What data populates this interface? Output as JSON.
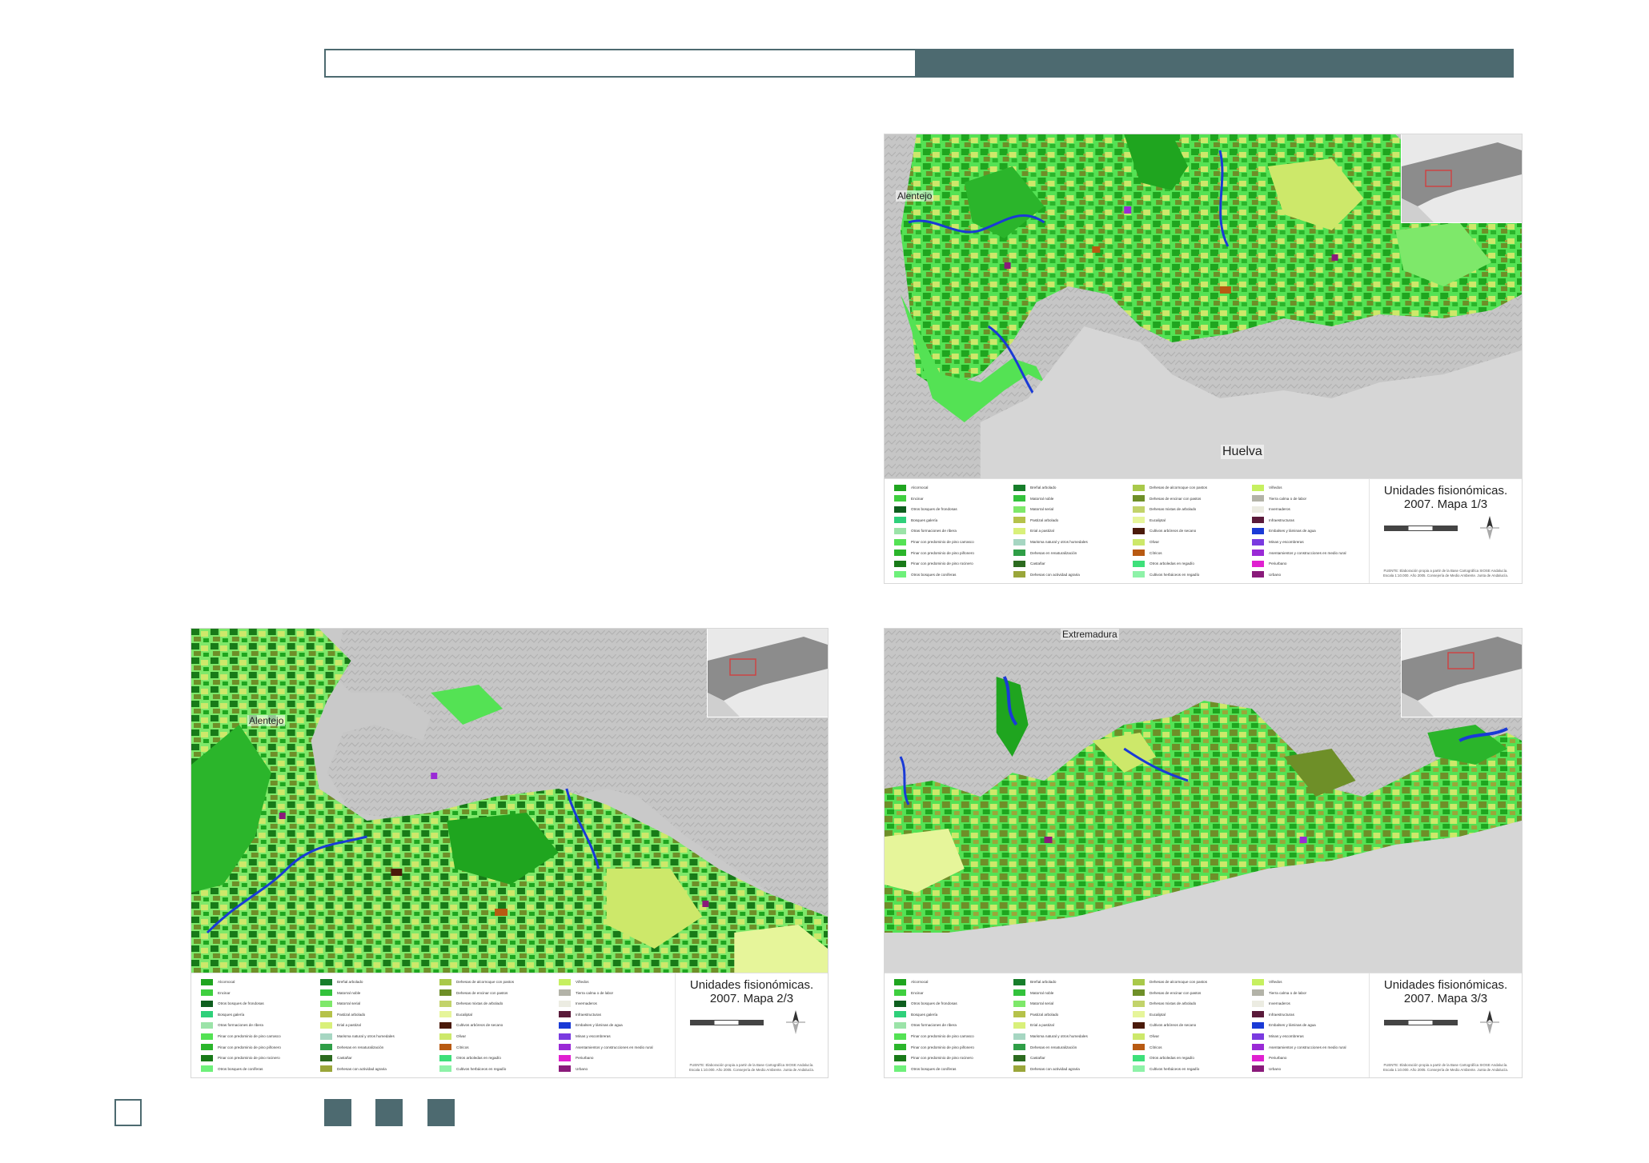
{
  "maps": [
    {
      "title_line1": "Unidades fisionómicas.",
      "title_line2": "2007. Mapa 1/3",
      "places": [
        "Alentejo",
        "Huelva"
      ]
    },
    {
      "title_line1": "Unidades fisionómicas.",
      "title_line2": "2007. Mapa 2/3",
      "places": [
        "Alentejo"
      ]
    },
    {
      "title_line1": "Unidades fisionómicas.",
      "title_line2": "2007. Mapa 3/3",
      "places": [
        "Extremadura"
      ]
    }
  ],
  "legend": [
    {
      "label": "Alcornocal",
      "color": "#1fa51f"
    },
    {
      "label": "Encinar",
      "color": "#3fcf3f"
    },
    {
      "label": "Otros bosques de frondosas",
      "color": "#0e5e1e"
    },
    {
      "label": "Bosques galería",
      "color": "#2ed07a"
    },
    {
      "label": "Otras formaciones de ribera",
      "color": "#9be3a8"
    },
    {
      "label": "Pinar con predominio de pino carrasco",
      "color": "#54e254"
    },
    {
      "label": "Pinar con predominio de pino piñonero",
      "color": "#2bb52b"
    },
    {
      "label": "Pinar con predominio de pino rocinero",
      "color": "#187a18"
    },
    {
      "label": "Otros bosques de coníferas",
      "color": "#6ef07a"
    },
    {
      "label": "Breñal arbolado",
      "color": "#167d2a"
    },
    {
      "label": "Matorral noble",
      "color": "#33c23c"
    },
    {
      "label": "Matorral serial",
      "color": "#7ee86a"
    },
    {
      "label": "Pastizal arbolado",
      "color": "#b5c24a"
    },
    {
      "label": "Erial a pastizal",
      "color": "#d9f07a"
    },
    {
      "label": "Marisma natural y otros humedales",
      "color": "#a6d6c2"
    },
    {
      "label": "Dehesas en renaturalización",
      "color": "#2f9e47"
    },
    {
      "label": "Castañar",
      "color": "#2c6b1f"
    },
    {
      "label": "Dehesas con actividad agraria",
      "color": "#9aa63a"
    },
    {
      "label": "Dehesas de alcornoque con pastos",
      "color": "#a9c94a"
    },
    {
      "label": "Dehesas de encinar con pastos",
      "color": "#6e8f28"
    },
    {
      "label": "Dehesas mixtas de arbolado",
      "color": "#c2d36a"
    },
    {
      "label": "Eucaliptal",
      "color": "#e6f59a"
    },
    {
      "label": "Cultivos arbóreos de secano",
      "color": "#4a1a0a"
    },
    {
      "label": "Olivar",
      "color": "#cde86a"
    },
    {
      "label": "Cítricos",
      "color": "#b85a12"
    },
    {
      "label": "Otros arboledas en regadío",
      "color": "#3ee07a"
    },
    {
      "label": "Cultivos herbáceos en regadío",
      "color": "#8ef2a8"
    },
    {
      "label": "Viñedos",
      "color": "#c6f060"
    },
    {
      "label": "Tierra calma o de labor",
      "color": "#b3b3a8"
    },
    {
      "label": "Invernaderos",
      "color": "#ecece2"
    },
    {
      "label": "Infraestructuras",
      "color": "#5a1a3a"
    },
    {
      "label": "Embalses y láminas de agua",
      "color": "#1a3ad6"
    },
    {
      "label": "Minas y escombreras",
      "color": "#7a3ae0"
    },
    {
      "label": "Asentamientos y construcciones en medio rural",
      "color": "#9a2ad6"
    },
    {
      "label": "Periurbano",
      "color": "#e020d0"
    },
    {
      "label": "Urbano",
      "color": "#8a1a7a"
    }
  ],
  "credit": "FUENTE: Elaboración propia a partir de la Base Cartográfica SIOSE Andalucía. Escala 1:10.000. Año 2005. Consejería de Medio Ambiente. Junta de Andalucía.",
  "colors": {
    "accent": "#4d6a70",
    "relief": "#c9c9c9",
    "sea": "#d6d6d6"
  }
}
